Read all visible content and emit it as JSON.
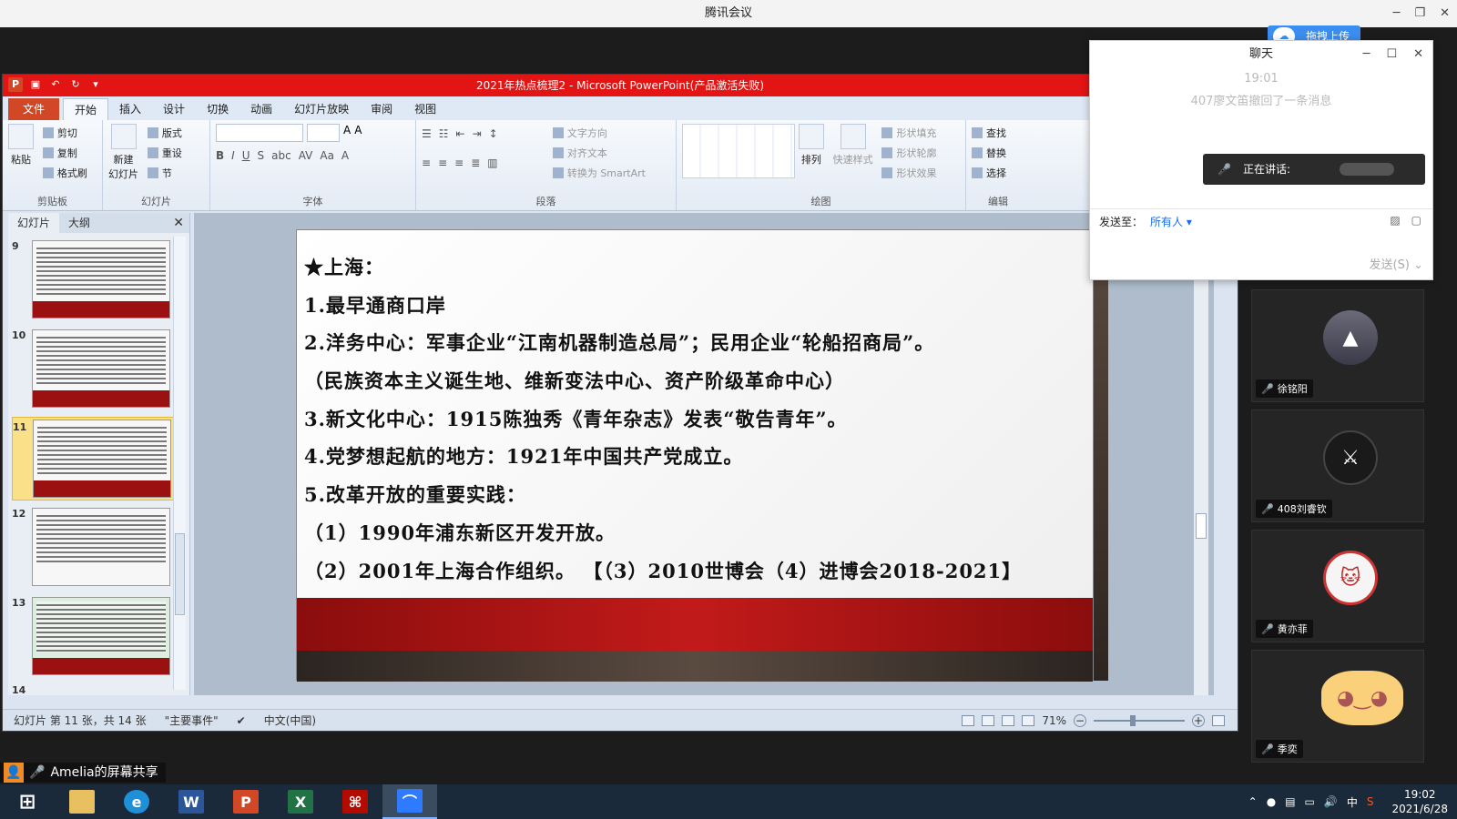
{
  "meeting": {
    "title": "腾讯会议"
  },
  "ppt": {
    "title": "2021年热点梳理2 - Microsoft PowerPoint(产品激活失败)",
    "tabs": [
      "文件",
      "开始",
      "插入",
      "设计",
      "切换",
      "动画",
      "幻灯片放映",
      "审阅",
      "视图"
    ],
    "ribbon": {
      "clipboard": {
        "paste": "粘贴",
        "cut": "剪切",
        "copy": "复制",
        "format": "格式刷",
        "label": "剪贴板"
      },
      "slides": {
        "new": "新建\n幻灯片",
        "layout": "版式",
        "reset": "重设",
        "section": "节",
        "label": "幻灯片"
      },
      "font": {
        "label": "字体"
      },
      "paragraph": {
        "text_dir": "文字方向",
        "align_text": "对齐文本",
        "smartart": "转换为 SmartArt",
        "label": "段落"
      },
      "drawing": {
        "arrange": "排列",
        "quick_styles": "快速样式",
        "fill": "形状填充",
        "outline": "形状轮廓",
        "effects": "形状效果",
        "label": "绘图"
      },
      "editing": {
        "find": "查找",
        "replace": "替换",
        "select": "选择",
        "label": "编辑"
      }
    },
    "panel": {
      "tab_slides": "幻灯片",
      "tab_outline": "大纲",
      "close": "✕"
    },
    "thumbs": [
      {
        "num": "9"
      },
      {
        "num": "10"
      },
      {
        "num": "11"
      },
      {
        "num": "12"
      },
      {
        "num": "13"
      },
      {
        "num": "14"
      }
    ],
    "slide_lines": [
      "★上海：",
      "1.最早通商口岸",
      "2.洋务中心：军事企业“江南机器制造总局”；民用企业“轮船招商局”。",
      "（民族资本主义诞生地、维新变法中心、资产阶级革命中心）",
      "3.新文化中心：1915陈独秀《青年杂志》发表“敬告青年”。",
      "4.党梦想起航的地方：1921年中国共产党成立。",
      "5.改革开放的重要实践：",
      "（1）1990年浦东新区开发开放。",
      "（2）2001年上海合作组织。 【（3）2010世博会（4）进博会2018-2021】"
    ],
    "status": {
      "slide_info": "幻灯片 第 11 张，共 14 张",
      "theme": "\"主要事件\"",
      "lang": "中文(中国)",
      "zoom": "71%"
    }
  },
  "chat": {
    "title": "聊天",
    "time": "19:01",
    "recall": "407廖文笛撤回了一条消息",
    "speaking": "正在讲话:",
    "send_to_label": "发送至：",
    "send_to_value": "所有人",
    "send": "发送(S)",
    "upload": "拖拽上传"
  },
  "participants": [
    {
      "name": "徐铭阳",
      "avatar_icon": "landscape-avatar"
    },
    {
      "name": "408刘睿钦",
      "avatar_icon": "emblem-avatar"
    },
    {
      "name": "黄亦菲",
      "avatar_icon": "cat-avatar"
    },
    {
      "name": "季奕",
      "avatar_icon": "cartoon-avatar"
    }
  ],
  "share_label": "Amelia的屏幕共享",
  "taskbar": {
    "time": "19:02",
    "date": "2021/6/28",
    "ime": "中"
  }
}
